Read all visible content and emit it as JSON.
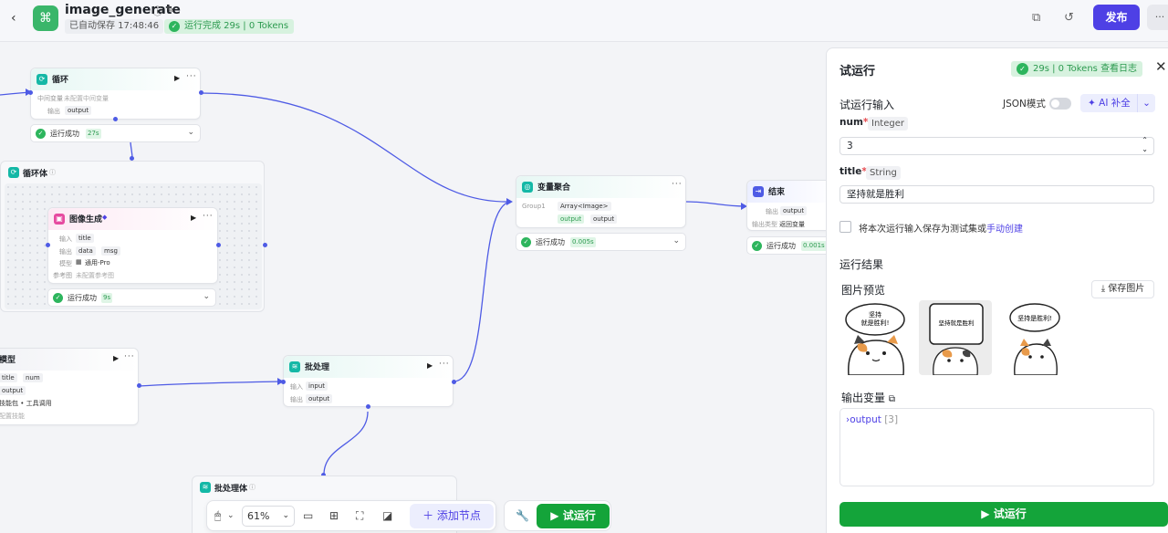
{
  "header": {
    "app_name": "image_generate",
    "saved": "已自动保存 17:48:46",
    "run_status": "运行完成 29s | 0 Tokens",
    "publish": "发布",
    "more": "···"
  },
  "nodes": {
    "loop": {
      "title": "循环",
      "var_label": "中间变量",
      "var_value": "未配置中间变量",
      "out_label": "输出",
      "out_value": "output",
      "status": "运行成功",
      "time": "27s"
    },
    "loop_body": {
      "title": "循环体"
    },
    "image_gen": {
      "title": "图像生成",
      "in_label": "输入",
      "in_value": "title",
      "out_label": "输出",
      "out_values": [
        "data",
        "msg"
      ],
      "model_label": "模型",
      "model_value": "通用-Pro",
      "ref_label": "参考图",
      "ref_value": "未配置参考图",
      "status": "运行成功",
      "time": "9s"
    },
    "var_merge": {
      "title": "变量聚合",
      "group_label": "Group1",
      "type_value": "Array<Image>",
      "out_values": [
        "output",
        "output"
      ],
      "status": "运行成功",
      "time": "0.005s"
    },
    "end": {
      "title": "结束",
      "out_label": "输出",
      "out_value": "output",
      "var_label": "输出类型",
      "var_value": "返回变量",
      "status": "运行成功",
      "time": "0.001s"
    },
    "model": {
      "title": "模型",
      "in_values": [
        "title",
        "num"
      ],
      "out_value": "output",
      "skill": "技能包 • 工具调用",
      "hint": "配置技能"
    },
    "batch": {
      "title": "批处理",
      "in_label": "输入",
      "in_value": "input",
      "out_label": "输出",
      "out_value": "output"
    },
    "batch_body": {
      "title": "批处理体"
    }
  },
  "toolbar": {
    "zoom": "61%",
    "add_node": "添加节点",
    "run": "试运行"
  },
  "panel": {
    "title": "试运行",
    "status": "29s | 0 Tokens",
    "view_log": "查看日志",
    "input_title": "试运行输入",
    "json_mode": "JSON模式",
    "ai_fill": "AI 补全",
    "fields": [
      {
        "name": "num",
        "type": "Integer",
        "value": "3"
      },
      {
        "name": "title",
        "type": "String",
        "value": "坚持就是胜利"
      }
    ],
    "save_testset": "将本次运行输入保存为测试集或",
    "manual_create": "手动创建",
    "result_title": "运行结果",
    "preview_title": "图片预览",
    "save_image": "保存图片",
    "images": [
      {
        "text": "坚持\n就是胜利!"
      },
      {
        "text": "坚持就是胜利"
      },
      {
        "text": "坚持是胜利!"
      }
    ],
    "output_title": "输出变量",
    "output_var": "output",
    "output_count": "[3]",
    "run_button": "试运行"
  }
}
